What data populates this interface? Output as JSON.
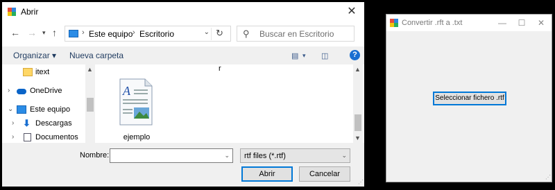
{
  "dialog": {
    "title": "Abrir",
    "address": {
      "crumbs": [
        "Este equipo",
        "Escritorio"
      ]
    },
    "search_placeholder": "Buscar en Escritorio",
    "organize_label": "Organizar ▾",
    "new_folder_label": "Nueva carpeta",
    "help_label": "?",
    "tree": [
      {
        "label": "itext",
        "icon": "folder-icon"
      },
      {
        "label": "OneDrive",
        "icon": "cloud-icon"
      },
      {
        "label": "Este equipo",
        "icon": "computer-icon"
      },
      {
        "label": "Descargas",
        "icon": "download-icon"
      },
      {
        "label": "Documentos",
        "icon": "documents-icon"
      }
    ],
    "top_label": "r",
    "files": [
      {
        "name": "ejemplo",
        "icon": "rtf-document-icon"
      }
    ],
    "filename_label": "Nombre:",
    "filename_value": "",
    "filter_value": "rtf files (*.rtf)",
    "open_label": "Abrir",
    "cancel_label": "Cancelar",
    "close_glyph": "✕"
  },
  "form": {
    "title": "Convertir .rft a .txt",
    "min_glyph": "—",
    "max_glyph": "☐",
    "close_glyph": "✕",
    "button_label": "Seleccionar fichero .rtf"
  },
  "colors": {
    "accent": "#0078d7",
    "folder": "#ffd766",
    "onedrive": "#0a64c8"
  }
}
